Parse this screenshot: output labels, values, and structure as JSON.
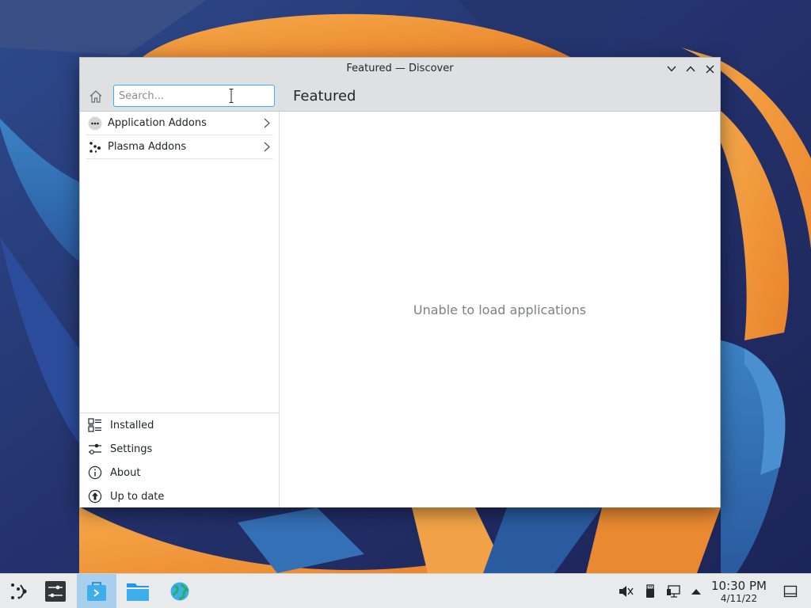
{
  "window": {
    "title": "Featured — Discover"
  },
  "toolbar": {
    "search_placeholder": "Search...",
    "page_title": "Featured"
  },
  "sidebar": {
    "categories": [
      {
        "label": "Application Addons",
        "icon": "more-dots-icon"
      },
      {
        "label": "Plasma Addons",
        "icon": "plasma-dots-icon"
      }
    ],
    "bottom": [
      {
        "label": "Installed",
        "icon": "installed-list-icon"
      },
      {
        "label": "Settings",
        "icon": "settings-sliders-icon"
      },
      {
        "label": "About",
        "icon": "info-icon"
      },
      {
        "label": "Up to date",
        "icon": "update-arrow-icon"
      }
    ]
  },
  "main": {
    "empty_message": "Unable to load applications"
  },
  "taskbar": {
    "time": "10:30 PM",
    "date": "4/11/22"
  },
  "colors": {
    "accent": "#3daee9",
    "titlebar": "#dee0e2",
    "taskbar": "#e8eaec"
  }
}
